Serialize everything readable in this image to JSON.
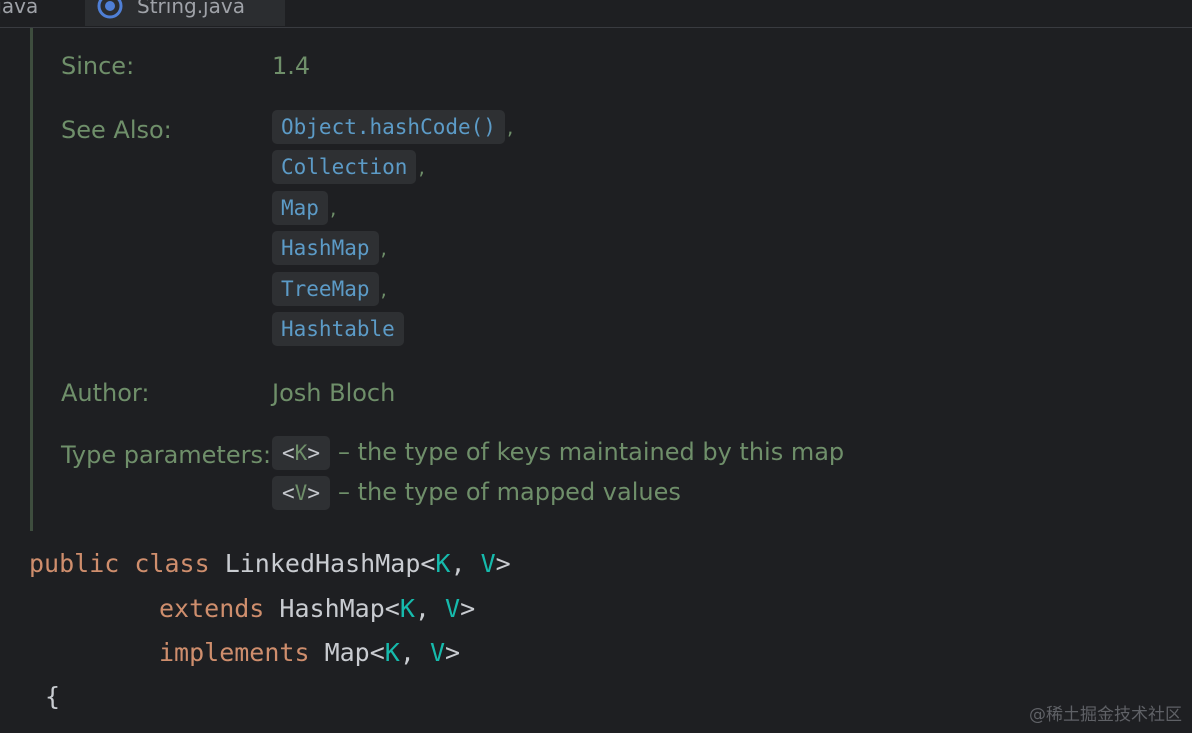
{
  "tabs": [
    {
      "label": ".java",
      "active": false
    },
    {
      "label": "String.java",
      "active": true,
      "icon": "class-icon"
    }
  ],
  "javadoc": {
    "since": {
      "label": "Since:",
      "value": "1.4"
    },
    "see_also": {
      "label": "See Also:",
      "items": [
        {
          "text": "Object.hashCode()",
          "sep": ","
        },
        {
          "text": "Collection",
          "sep": ","
        },
        {
          "text": "Map",
          "sep": ","
        },
        {
          "text": "HashMap",
          "sep": ","
        },
        {
          "text": "TreeMap",
          "sep": ","
        },
        {
          "text": "Hashtable",
          "sep": ""
        }
      ]
    },
    "author": {
      "label": "Author:",
      "value": "Josh Bloch"
    },
    "type_parameters": {
      "label": "Type parameters:",
      "items": [
        {
          "open": "<",
          "letter": "K",
          "close": ">",
          "desc": "– the type of keys maintained by this map"
        },
        {
          "open": "<",
          "letter": "V",
          "close": ">",
          "desc": "– the type of mapped values"
        }
      ]
    }
  },
  "code": {
    "line1": {
      "kw1": "public",
      "kw2": "class",
      "name": "LinkedHashMap<",
      "t1": "K",
      "comma": ", ",
      "t2": "V",
      "close": ">"
    },
    "line2": {
      "kw": "extends",
      "name": "HashMap<",
      "t1": "K",
      "comma": ", ",
      "t2": "V",
      "close": ">"
    },
    "line3": {
      "kw": "implements",
      "name": "Map<",
      "t1": "K",
      "comma": ", ",
      "t2": "V",
      "close": ">"
    },
    "line4": {
      "brace": "{"
    }
  },
  "watermark": "@稀土掘金技术社区",
  "colors": {
    "background": "#1e1f22",
    "doc_text": "#6f8f6a",
    "link": "#5c9bc7",
    "keyword": "#cf8e6d",
    "type_param": "#16baac"
  }
}
